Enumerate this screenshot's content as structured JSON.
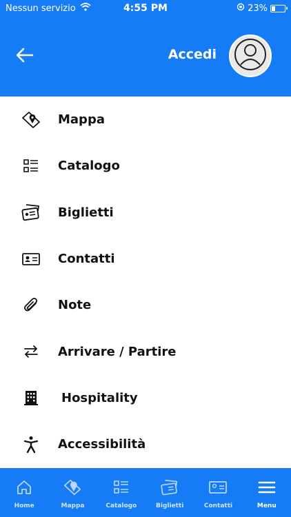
{
  "status_bar": {
    "carrier": "Nessun servizio",
    "time": "4:55 PM",
    "battery_text": "23%",
    "battery_level": 0.23,
    "icons": [
      "wifi-icon",
      "orientation-lock-icon",
      "battery-charging-icon"
    ]
  },
  "header": {
    "back_icon": "arrow-left-icon",
    "login_label": "Accedi",
    "avatar_icon": "user-icon"
  },
  "menu": {
    "items": [
      {
        "label": "Mappa",
        "icon": "map-pin-icon"
      },
      {
        "label": "Catalogo",
        "icon": "list-icon"
      },
      {
        "label": "Biglietti",
        "icon": "tickets-icon"
      },
      {
        "label": "Contatti",
        "icon": "contact-card-icon"
      },
      {
        "label": "Note",
        "icon": "paperclip-icon"
      },
      {
        "label": "Arrivare / Partire",
        "icon": "arrows-swap-icon"
      },
      {
        "label": " Hospitality",
        "icon": "building-icon"
      },
      {
        "label": "Accessibilità",
        "icon": "accessibility-icon"
      }
    ]
  },
  "tab_bar": {
    "tabs": [
      {
        "label": "Home",
        "icon": "home-icon"
      },
      {
        "label": "Mappa",
        "icon": "map-pin-icon"
      },
      {
        "label": "Catalogo",
        "icon": "list-icon"
      },
      {
        "label": "Biglietti",
        "icon": "tickets-icon"
      },
      {
        "label": "Contatti",
        "icon": "contact-card-icon"
      },
      {
        "label": "Menu",
        "icon": "hamburger-icon"
      }
    ],
    "active_tab": "Menu"
  },
  "colors": {
    "primary": "#157cf6",
    "text": "#111111",
    "background": "#ffffff"
  }
}
